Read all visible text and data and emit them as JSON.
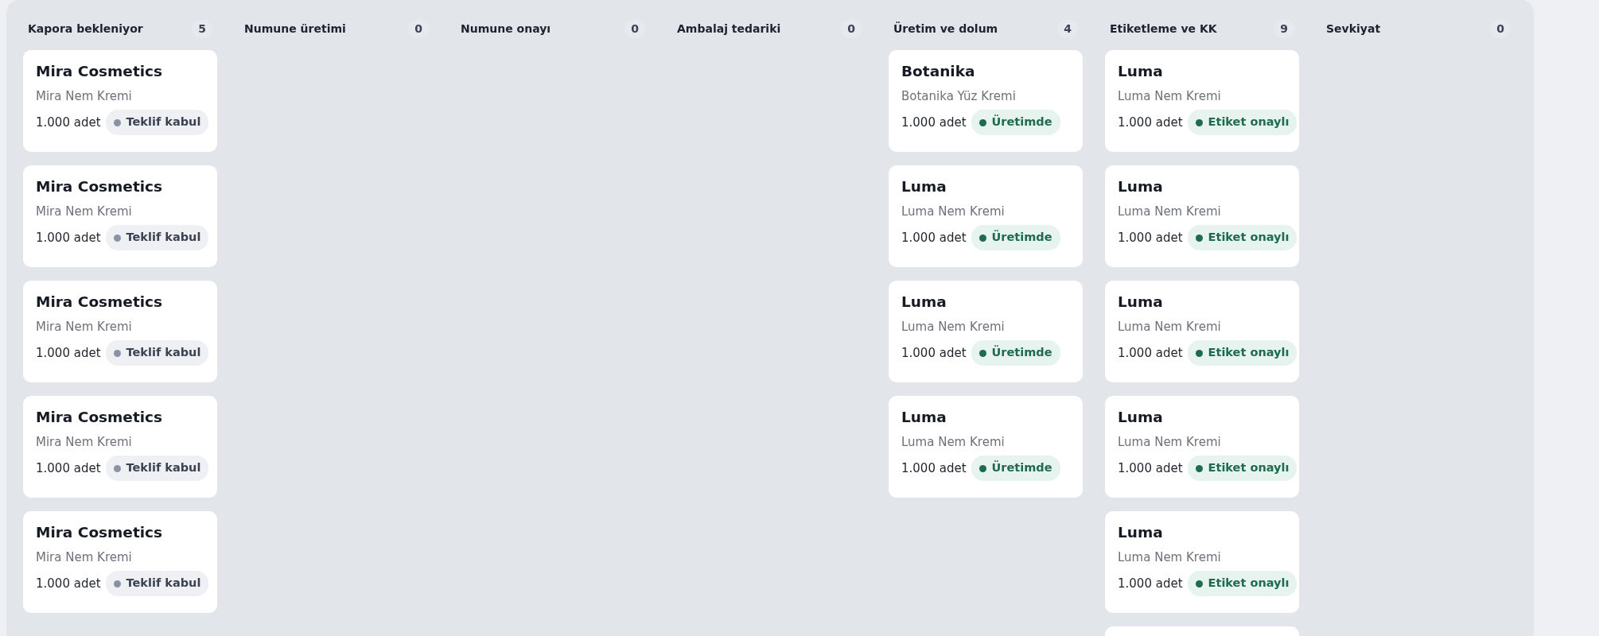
{
  "columns": [
    {
      "title": "Kapora bekleniyor",
      "count": "5",
      "cards": [
        {
          "company": "Mira Cosmetics",
          "product": "Mira Nem Kremi",
          "quantity": "1.000 adet",
          "status": {
            "label": "Teklif kabul",
            "kind": "pending"
          }
        },
        {
          "company": "Mira Cosmetics",
          "product": "Mira Nem Kremi",
          "quantity": "1.000 adet",
          "status": {
            "label": "Teklif kabul",
            "kind": "pending"
          }
        },
        {
          "company": "Mira Cosmetics",
          "product": "Mira Nem Kremi",
          "quantity": "1.000 adet",
          "status": {
            "label": "Teklif kabul",
            "kind": "pending"
          }
        },
        {
          "company": "Mira Cosmetics",
          "product": "Mira Nem Kremi",
          "quantity": "1.000 adet",
          "status": {
            "label": "Teklif kabul",
            "kind": "pending"
          }
        },
        {
          "company": "Mira Cosmetics",
          "product": "Mira Nem Kremi",
          "quantity": "1.000 adet",
          "status": {
            "label": "Teklif kabul",
            "kind": "pending"
          }
        }
      ]
    },
    {
      "title": "Numune üretimi",
      "count": "0"
    },
    {
      "title": "Numune onayı",
      "count": "0"
    },
    {
      "title": "Ambalaj tedariki",
      "count": "0"
    },
    {
      "title": "Üretim ve dolum",
      "count": "4",
      "cards": [
        {
          "company": "Botanika",
          "product": "Botanika Yüz Kremi",
          "quantity": "1.000 adet",
          "status": {
            "label": "Üretimde",
            "kind": "done"
          }
        },
        {
          "company": "Luma",
          "product": "Luma Nem Kremi",
          "quantity": "1.000 adet",
          "status": {
            "label": "Üretimde",
            "kind": "done"
          }
        },
        {
          "company": "Luma",
          "product": "Luma Nem Kremi",
          "quantity": "1.000 adet",
          "status": {
            "label": "Üretimde",
            "kind": "done"
          }
        },
        {
          "company": "Luma",
          "product": "Luma Nem Kremi",
          "quantity": "1.000 adet",
          "status": {
            "label": "Üretimde",
            "kind": "done"
          }
        }
      ]
    },
    {
      "title": "Etiketleme ve KK",
      "count": "9",
      "more_below": true,
      "cards": [
        {
          "company": "Luma",
          "product": "Luma Nem Kremi",
          "quantity": "1.000 adet",
          "status": {
            "label": "Etiket onaylı",
            "kind": "done"
          }
        },
        {
          "company": "Luma",
          "product": "Luma Nem Kremi",
          "quantity": "1.000 adet",
          "status": {
            "label": "Etiket onaylı",
            "kind": "done"
          }
        },
        {
          "company": "Luma",
          "product": "Luma Nem Kremi",
          "quantity": "1.000 adet",
          "status": {
            "label": "Etiket onaylı",
            "kind": "done"
          }
        },
        {
          "company": "Luma",
          "product": "Luma Nem Kremi",
          "quantity": "1.000 adet",
          "status": {
            "label": "Etiket onaylı",
            "kind": "done"
          }
        },
        {
          "company": "Luma",
          "product": "Luma Nem Kremi",
          "quantity": "1.000 adet",
          "status": {
            "label": "Etiket onaylı",
            "kind": "done"
          }
        }
      ]
    },
    {
      "title": "Sevkiyat",
      "count": "0"
    }
  ]
}
